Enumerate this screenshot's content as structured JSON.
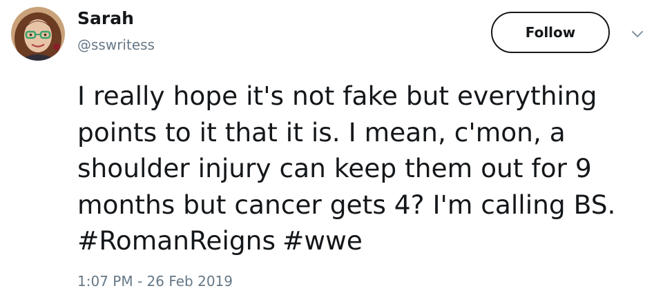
{
  "user": {
    "display_name": "Sarah",
    "handle": "@sswritess"
  },
  "actions": {
    "follow_label": "Follow"
  },
  "tweet": {
    "text": "I really hope it's not fake but everything\npoints to it that it is. I mean, c'mon, a\nshoulder injury can keep them out for 9\nmonths but cancer gets 4? I'm calling BS.",
    "hashtags": [
      "#RomanReigns",
      "#wwe"
    ],
    "timestamp": "1:07 PM - 26 Feb 2019"
  },
  "icons": {
    "avatar": "avatar-image",
    "caret": "chevron-down-icon"
  },
  "colors": {
    "text": "#14171a",
    "secondary": "#657786",
    "background": "#ffffff"
  }
}
